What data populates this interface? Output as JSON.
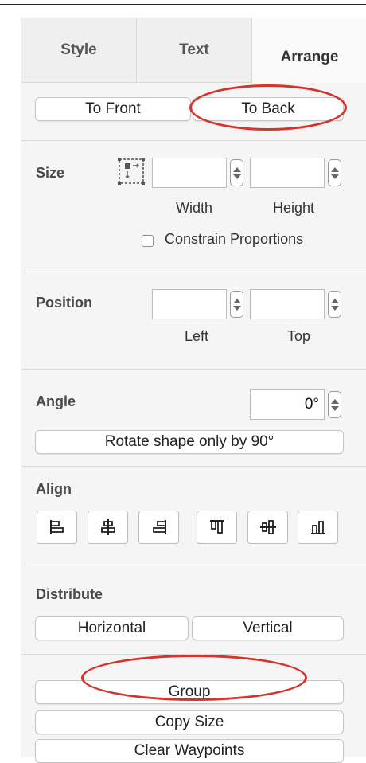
{
  "tabs": [
    {
      "label": "Style",
      "active": false
    },
    {
      "label": "Text",
      "active": false
    },
    {
      "label": "Arrange",
      "active": true
    }
  ],
  "order": {
    "to_front": "To Front",
    "to_back": "To Back"
  },
  "size": {
    "label": "Size",
    "width_value": "",
    "height_value": "",
    "width_caption": "Width",
    "height_caption": "Height",
    "constrain_label": "Constrain Proportions",
    "constrain_checked": false
  },
  "position": {
    "label": "Position",
    "left_value": "",
    "top_value": "",
    "left_caption": "Left",
    "top_caption": "Top"
  },
  "angle": {
    "label": "Angle",
    "value": "0°",
    "rotate_button": "Rotate shape only by 90°"
  },
  "align": {
    "label": "Align",
    "buttons": [
      "align-left-icon",
      "align-center-icon",
      "align-right-icon",
      "align-top-icon",
      "align-middle-icon",
      "align-bottom-icon"
    ]
  },
  "distribute": {
    "label": "Distribute",
    "horizontal": "Horizontal",
    "vertical": "Vertical"
  },
  "actions": {
    "group": "Group",
    "copy_size": "Copy Size",
    "clear_waypoints": "Clear Waypoints"
  },
  "colors": {
    "highlight": "#d6332a",
    "panel_bg": "#f5f5f5"
  }
}
